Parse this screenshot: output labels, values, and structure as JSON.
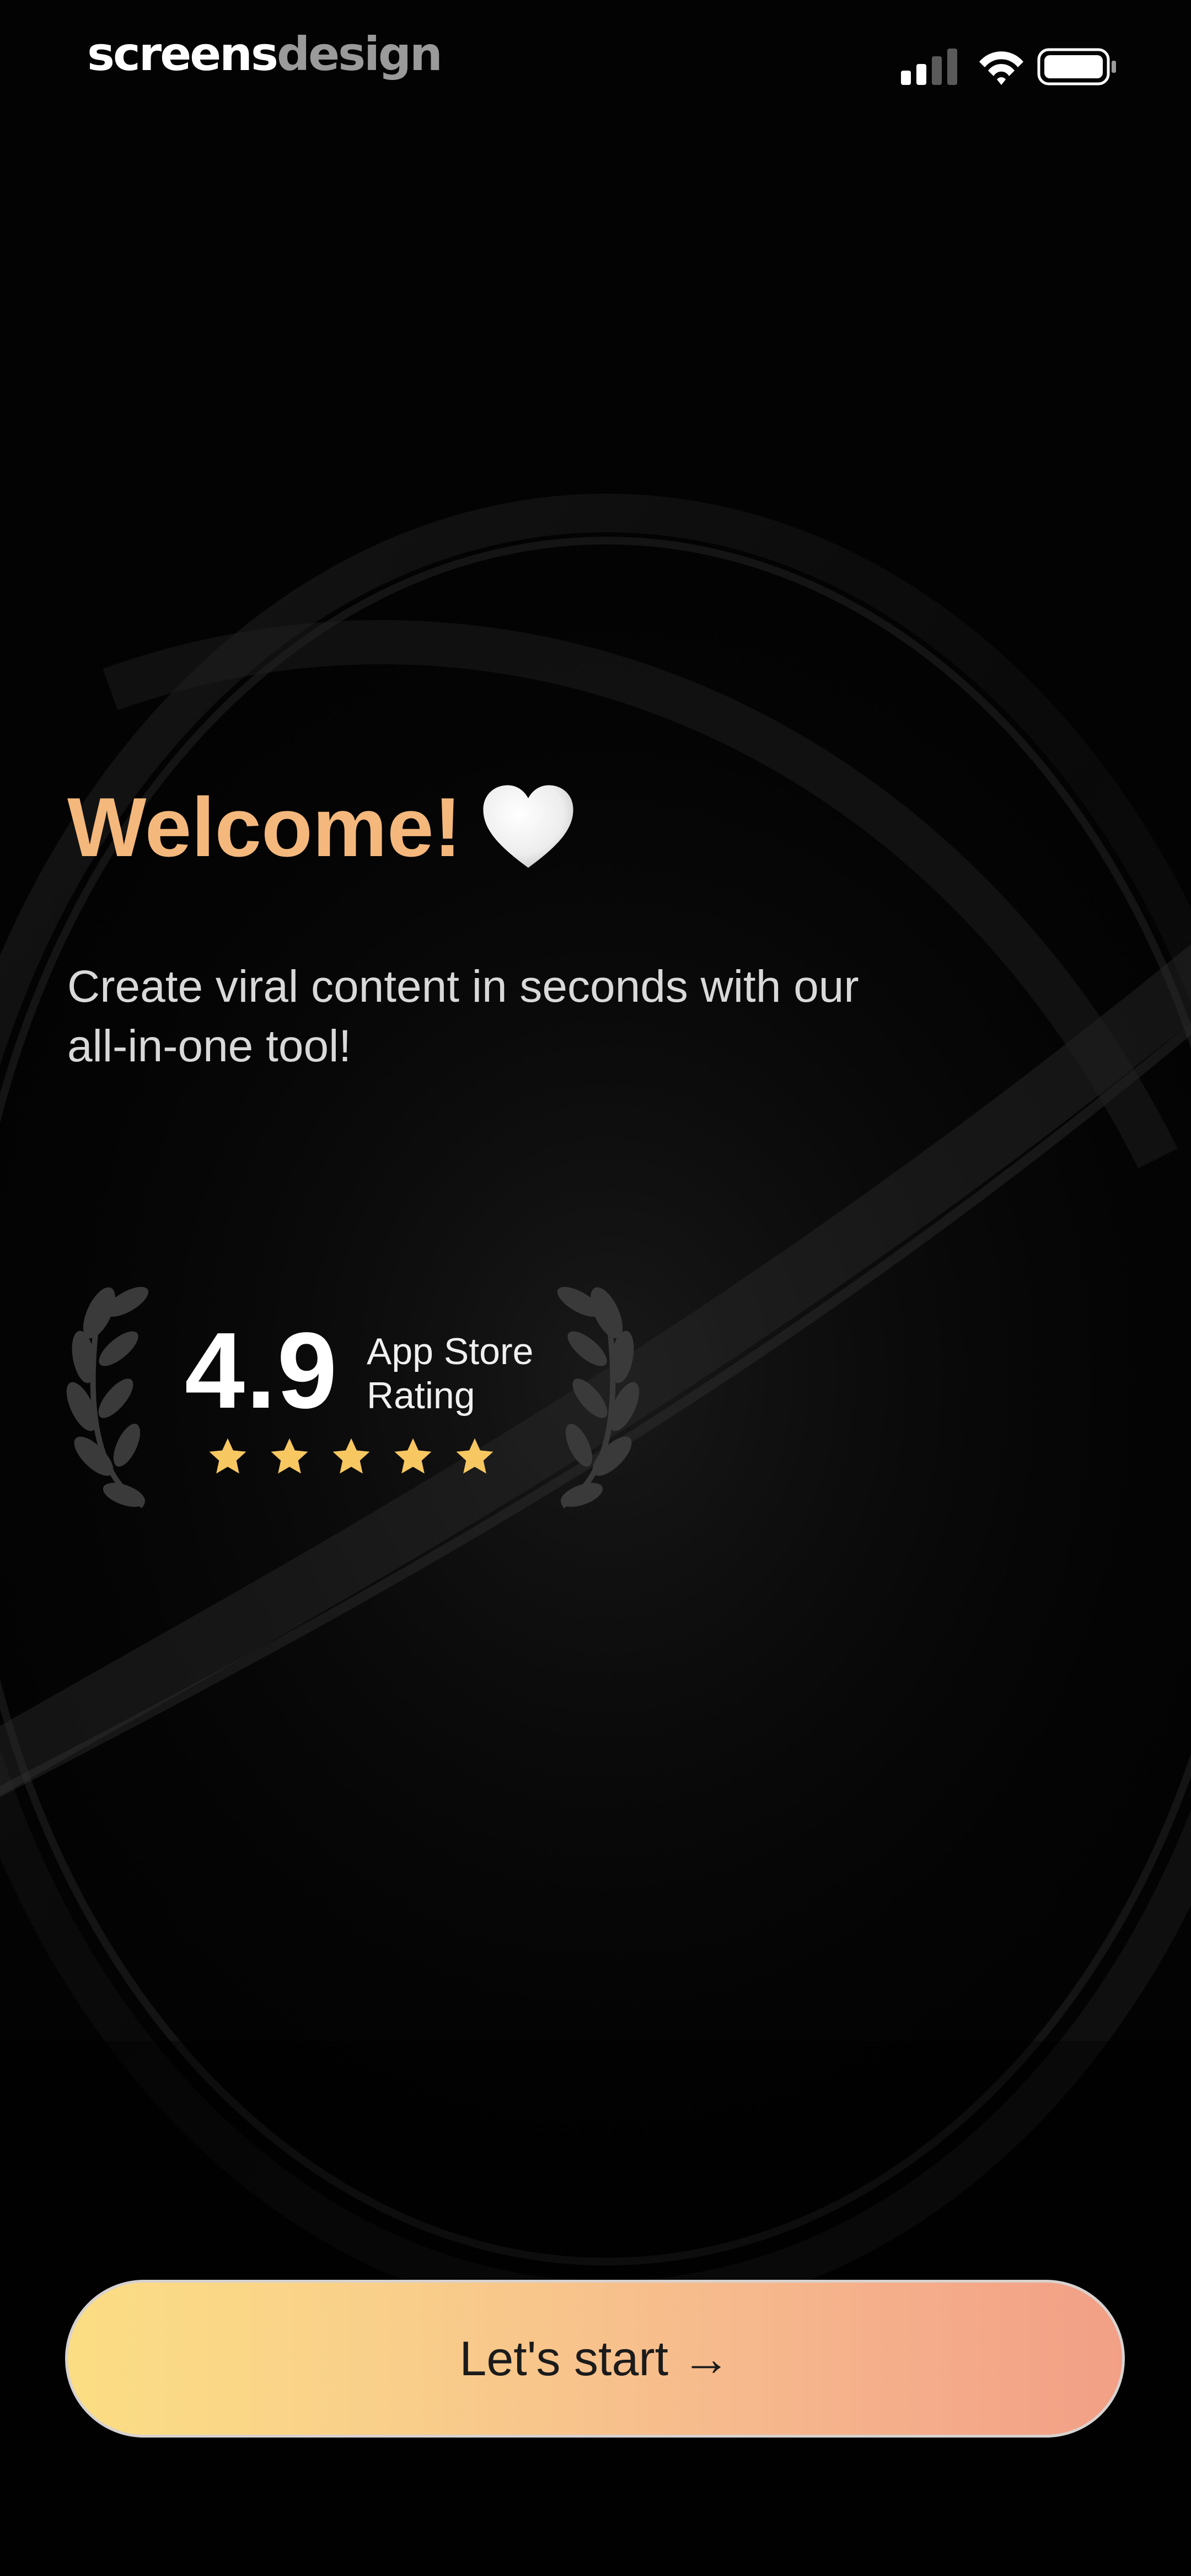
{
  "status_bar": {
    "brand_primary": "screens",
    "brand_secondary": "design",
    "icons": [
      "cellular-signal-icon",
      "wifi-icon",
      "battery-icon"
    ]
  },
  "welcome": {
    "title": "Welcome!",
    "title_emoji_icon": "white-heart-icon",
    "subtitle": "Create viral content in seconds with our all-in-one tool!"
  },
  "rating": {
    "value": "4.9",
    "label_line1": "App Store",
    "label_line2": "Rating",
    "stars": 5,
    "max_stars": 5
  },
  "cta": {
    "label": "Let's start →"
  },
  "colors": {
    "background": "#030303",
    "title_accent": "#f4b87c",
    "star": "#f7c761",
    "button_gradient_start": "#fbde84",
    "button_gradient_end": "#f29f86"
  }
}
